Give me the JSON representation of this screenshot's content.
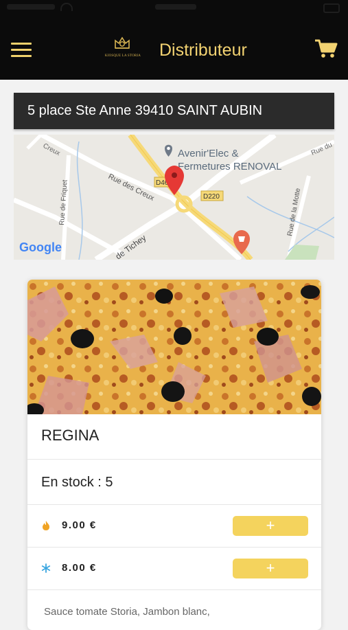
{
  "header": {
    "title": "Distributeur",
    "logo_text": "KIOSQUE LA STORIA",
    "menu_icon": "hamburger-menu-icon",
    "cart_icon": "shopping-cart-icon",
    "background": "#0b0b0b",
    "accent": "#f2d271"
  },
  "location": {
    "address": "5 place Ste Anne 39410 SAINT AUBIN"
  },
  "map": {
    "labels": {
      "poi": "Avenir'Elec &",
      "poi_line2": "Fermetures RENOVAL",
      "road_d220": "D220",
      "road_d46": "D46",
      "rue_des_creux": "Rue des Creux",
      "rue_de_friquet": "Rue de Friquet",
      "rue_de_tichey": "de Tichey",
      "rue_de_la_motte": "Rue de la Motte",
      "creux_top": "Creux",
      "rue_du_top": "Rue du",
      "google": "Google"
    }
  },
  "product": {
    "name": "REGINA",
    "stock": "En stock : 5",
    "prices": [
      {
        "icon": "flame-icon",
        "value": "9.00  €",
        "button": "+"
      },
      {
        "icon": "snowflake-icon",
        "value": "8.00  €",
        "button": "+"
      }
    ],
    "description": "Sauce tomate Storia, Jambon blanc,"
  },
  "colors": {
    "button": "#f4d35d",
    "flame": "#f0a324",
    "snowflake": "#3aa6e0"
  }
}
